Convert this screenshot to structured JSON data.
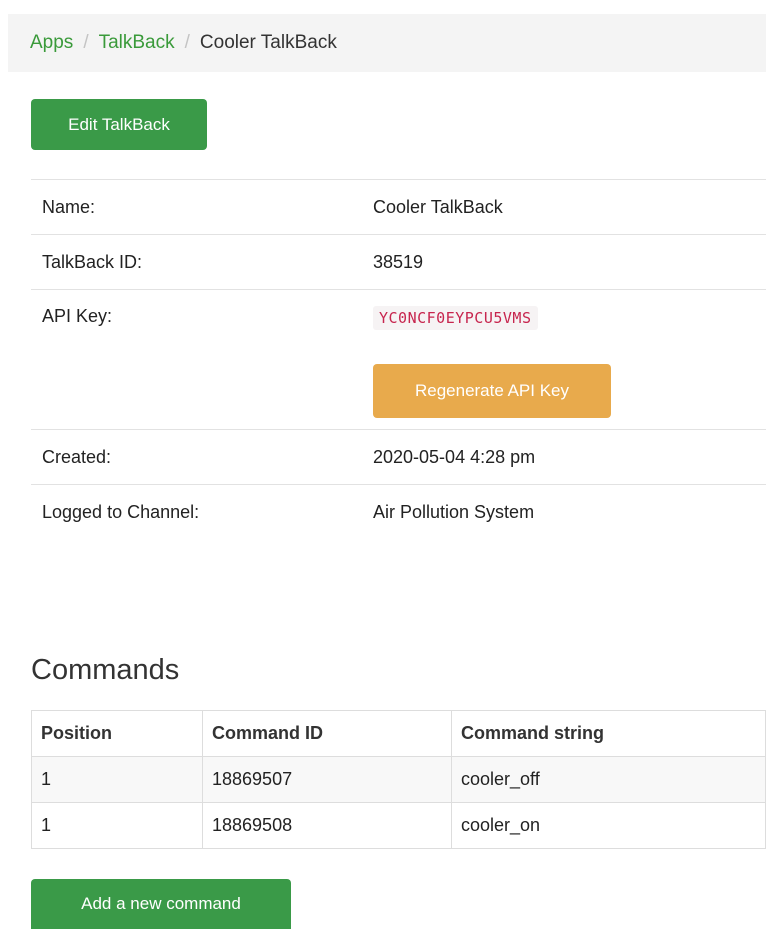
{
  "breadcrumb": {
    "items": [
      {
        "label": "Apps"
      },
      {
        "label": "TalkBack"
      }
    ],
    "separator": "/",
    "current": "Cooler TalkBack"
  },
  "actions": {
    "edit_label": "Edit TalkBack",
    "regenerate_label": "Regenerate API Key",
    "add_command_label": "Add a new command"
  },
  "details": {
    "name_label": "Name:",
    "name_value": "Cooler TalkBack",
    "id_label": "TalkBack ID:",
    "id_value": "38519",
    "api_key_label": "API Key:",
    "api_key_value": "YC0NCF0EYPCU5VMS",
    "created_label": "Created:",
    "created_value": "2020-05-04 4:28 pm",
    "channel_label": "Logged to Channel:",
    "channel_value": "Air Pollution System"
  },
  "commands": {
    "title": "Commands",
    "headers": [
      "Position",
      "Command ID",
      "Command string"
    ],
    "rows": [
      [
        "1",
        "18869507",
        "cooler_off"
      ],
      [
        "1",
        "18869508",
        "cooler_on"
      ]
    ]
  },
  "colors": {
    "link": "#3a9a3a",
    "primary_button": "#3a9a48",
    "warning_button": "#e8aa4c",
    "code_text": "#c7254e"
  }
}
